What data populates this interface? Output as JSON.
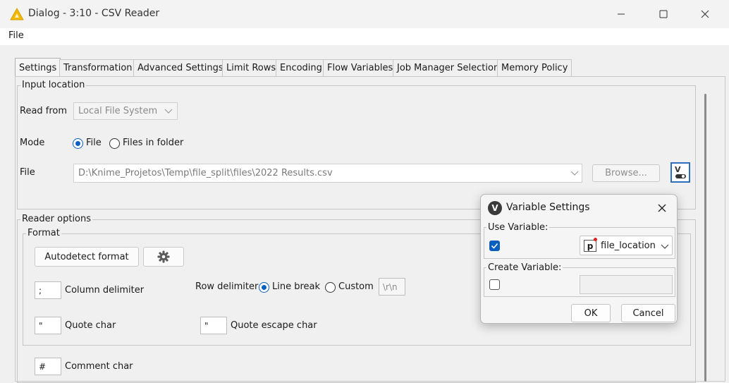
{
  "window": {
    "title": "Dialog - 3:10 - CSV Reader",
    "minimize_glyph": "—",
    "maximize_glyph": "☐",
    "close_glyph": "✕"
  },
  "menu": {
    "file": "File"
  },
  "tabs": [
    {
      "label": "Settings"
    },
    {
      "label": "Transformation"
    },
    {
      "label": "Advanced Settings"
    },
    {
      "label": "Limit Rows"
    },
    {
      "label": "Encoding"
    },
    {
      "label": "Flow Variables"
    },
    {
      "label": "Job Manager Selection"
    },
    {
      "label": "Memory Policy"
    }
  ],
  "input_location": {
    "title": "Input location",
    "read_from_label": "Read from",
    "read_from_value": "Local File System",
    "mode_label": "Mode",
    "mode_file": "File",
    "mode_folder": "Files in folder",
    "file_label": "File",
    "file_path": "D:\\Knime_Projetos\\Temp\\file_split\\files\\2022 Results.csv",
    "browse_label": "Browse..."
  },
  "reader_options": {
    "title": "Reader options",
    "format_title": "Format",
    "autodetect_label": "Autodetect format",
    "column_delimiter_value": ";",
    "column_delimiter_label": "Column delimiter",
    "row_delimiter_label": "Row delimiter",
    "line_break_label": "Line break",
    "custom_label": "Custom",
    "custom_value": "\\r\\n",
    "quote_char_value": "\"",
    "quote_char_label": "Quote char",
    "quote_escape_value": "\"",
    "quote_escape_label": "Quote escape char",
    "comment_char_value": "#",
    "comment_char_label": "Comment char"
  },
  "variable_settings": {
    "icon_letter": "V",
    "title": "Variable Settings",
    "use_variable_title": "Use Variable:",
    "use_variable_checked": true,
    "variable_type_badge": "p",
    "variable_name": "file_location",
    "create_variable_title": "Create Variable:",
    "create_variable_checked": false,
    "ok_label": "OK",
    "cancel_label": "Cancel"
  },
  "colors": {
    "accent": "#0a5fbf",
    "knime_logo": "#f5b800",
    "variable_badge": "#e02020"
  }
}
